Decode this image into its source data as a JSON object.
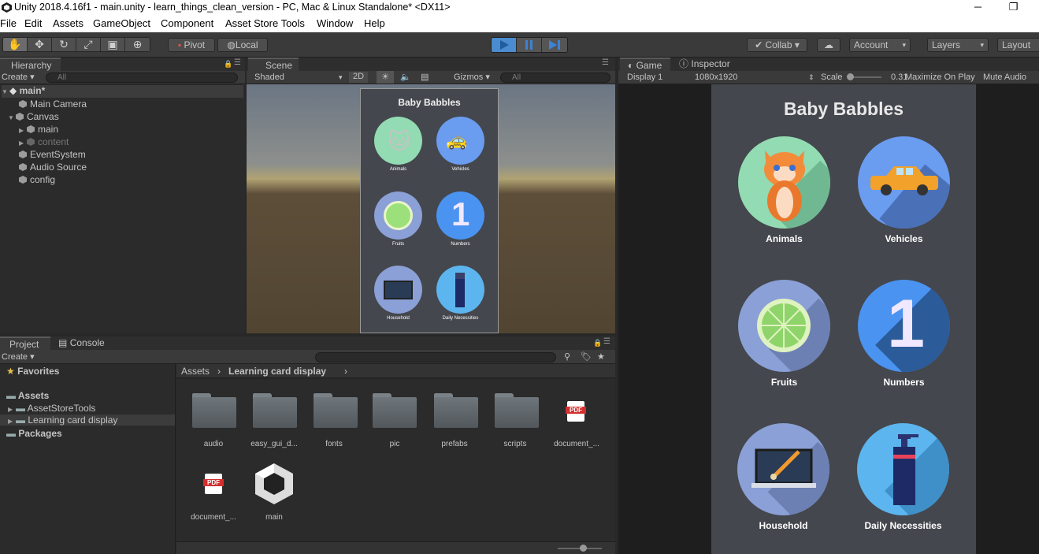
{
  "window": {
    "title": "Unity 2018.4.16f1 - main.unity - learn_things_clean_version - PC, Mac & Linux Standalone* <DX11>",
    "minimize": "─",
    "restore": "❐"
  },
  "menu": [
    "File",
    "Edit",
    "Assets",
    "GameObject",
    "Component",
    "Asset Store Tools",
    "Window",
    "Help"
  ],
  "toolbar": {
    "pivot": "Pivot",
    "local": "Local",
    "collab": "Collab ▾",
    "account": "Account",
    "layers": "Layers",
    "layout": "Layout"
  },
  "hierarchy": {
    "tab": "Hierarchy",
    "create": "Create ▾",
    "search_placeholder": "All",
    "scene": "main*",
    "items": [
      "Main Camera",
      "Canvas",
      "main",
      "content",
      "EventSystem",
      "Audio Source",
      "config"
    ]
  },
  "scene": {
    "tab": "Scene",
    "shading": "Shaded",
    "mode2d": "2D",
    "gizmos": "Gizmos ▾",
    "search_placeholder": "All"
  },
  "game": {
    "tab": "Game",
    "inspector_tab": "Inspector",
    "display": "Display 1",
    "resolution": "1080x1920",
    "scale_label": "Scale",
    "scale_value": "0.31",
    "maximize": "Maximize On Play",
    "mute": "Mute Audio"
  },
  "app": {
    "title": "Baby Babbles",
    "cards": [
      "Animals",
      "Vehicles",
      "Fruits",
      "Numbers",
      "Household",
      "Daily Necessities"
    ],
    "number_glyph": "1"
  },
  "project": {
    "tab": "Project",
    "console_tab": "Console",
    "create": "Create ▾",
    "favorites": "Favorites",
    "assets": "Assets",
    "asset_children": [
      "AssetStoreTools",
      "Learning card display"
    ],
    "packages": "Packages",
    "breadcrumb_root": "Assets",
    "breadcrumb_current": "Learning card display",
    "files": [
      "audio",
      "easy_gui_d...",
      "fonts",
      "pic",
      "prefabs",
      "scripts",
      "document_...",
      "document_...",
      "main"
    ],
    "pdf_label": "PDF"
  },
  "colors": {
    "play": "#4a8ccf",
    "cat": "#93dbb2",
    "car": "#6a9cf0",
    "lime": "#8aa0d6",
    "number": "#4a93f0",
    "laptop": "#8aa0d6",
    "bottle": "#5cb5ee"
  }
}
